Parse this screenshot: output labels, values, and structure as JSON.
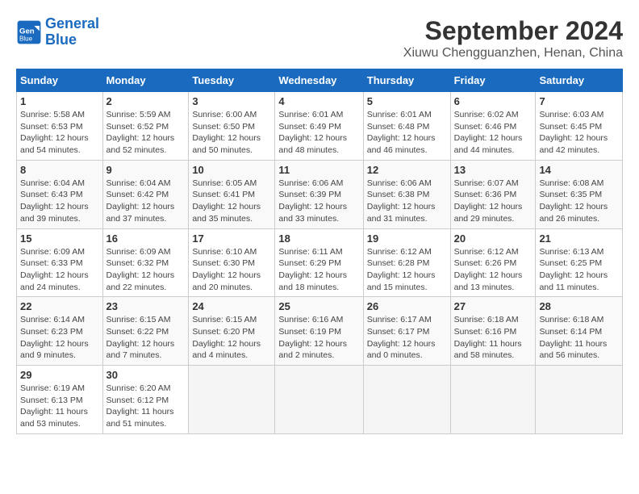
{
  "header": {
    "logo_line1": "General",
    "logo_line2": "Blue",
    "title": "September 2024",
    "subtitle": "Xiuwu Chengguanzhen, Henan, China"
  },
  "weekdays": [
    "Sunday",
    "Monday",
    "Tuesday",
    "Wednesday",
    "Thursday",
    "Friday",
    "Saturday"
  ],
  "weeks": [
    [
      {
        "day": "1",
        "sunrise": "5:58 AM",
        "sunset": "6:53 PM",
        "daylight": "12 hours and 54 minutes."
      },
      {
        "day": "2",
        "sunrise": "5:59 AM",
        "sunset": "6:52 PM",
        "daylight": "12 hours and 52 minutes."
      },
      {
        "day": "3",
        "sunrise": "6:00 AM",
        "sunset": "6:50 PM",
        "daylight": "12 hours and 50 minutes."
      },
      {
        "day": "4",
        "sunrise": "6:01 AM",
        "sunset": "6:49 PM",
        "daylight": "12 hours and 48 minutes."
      },
      {
        "day": "5",
        "sunrise": "6:01 AM",
        "sunset": "6:48 PM",
        "daylight": "12 hours and 46 minutes."
      },
      {
        "day": "6",
        "sunrise": "6:02 AM",
        "sunset": "6:46 PM",
        "daylight": "12 hours and 44 minutes."
      },
      {
        "day": "7",
        "sunrise": "6:03 AM",
        "sunset": "6:45 PM",
        "daylight": "12 hours and 42 minutes."
      }
    ],
    [
      {
        "day": "8",
        "sunrise": "6:04 AM",
        "sunset": "6:43 PM",
        "daylight": "12 hours and 39 minutes."
      },
      {
        "day": "9",
        "sunrise": "6:04 AM",
        "sunset": "6:42 PM",
        "daylight": "12 hours and 37 minutes."
      },
      {
        "day": "10",
        "sunrise": "6:05 AM",
        "sunset": "6:41 PM",
        "daylight": "12 hours and 35 minutes."
      },
      {
        "day": "11",
        "sunrise": "6:06 AM",
        "sunset": "6:39 PM",
        "daylight": "12 hours and 33 minutes."
      },
      {
        "day": "12",
        "sunrise": "6:06 AM",
        "sunset": "6:38 PM",
        "daylight": "12 hours and 31 minutes."
      },
      {
        "day": "13",
        "sunrise": "6:07 AM",
        "sunset": "6:36 PM",
        "daylight": "12 hours and 29 minutes."
      },
      {
        "day": "14",
        "sunrise": "6:08 AM",
        "sunset": "6:35 PM",
        "daylight": "12 hours and 26 minutes."
      }
    ],
    [
      {
        "day": "15",
        "sunrise": "6:09 AM",
        "sunset": "6:33 PM",
        "daylight": "12 hours and 24 minutes."
      },
      {
        "day": "16",
        "sunrise": "6:09 AM",
        "sunset": "6:32 PM",
        "daylight": "12 hours and 22 minutes."
      },
      {
        "day": "17",
        "sunrise": "6:10 AM",
        "sunset": "6:30 PM",
        "daylight": "12 hours and 20 minutes."
      },
      {
        "day": "18",
        "sunrise": "6:11 AM",
        "sunset": "6:29 PM",
        "daylight": "12 hours and 18 minutes."
      },
      {
        "day": "19",
        "sunrise": "6:12 AM",
        "sunset": "6:28 PM",
        "daylight": "12 hours and 15 minutes."
      },
      {
        "day": "20",
        "sunrise": "6:12 AM",
        "sunset": "6:26 PM",
        "daylight": "12 hours and 13 minutes."
      },
      {
        "day": "21",
        "sunrise": "6:13 AM",
        "sunset": "6:25 PM",
        "daylight": "12 hours and 11 minutes."
      }
    ],
    [
      {
        "day": "22",
        "sunrise": "6:14 AM",
        "sunset": "6:23 PM",
        "daylight": "12 hours and 9 minutes."
      },
      {
        "day": "23",
        "sunrise": "6:15 AM",
        "sunset": "6:22 PM",
        "daylight": "12 hours and 7 minutes."
      },
      {
        "day": "24",
        "sunrise": "6:15 AM",
        "sunset": "6:20 PM",
        "daylight": "12 hours and 4 minutes."
      },
      {
        "day": "25",
        "sunrise": "6:16 AM",
        "sunset": "6:19 PM",
        "daylight": "12 hours and 2 minutes."
      },
      {
        "day": "26",
        "sunrise": "6:17 AM",
        "sunset": "6:17 PM",
        "daylight": "12 hours and 0 minutes."
      },
      {
        "day": "27",
        "sunrise": "6:18 AM",
        "sunset": "6:16 PM",
        "daylight": "11 hours and 58 minutes."
      },
      {
        "day": "28",
        "sunrise": "6:18 AM",
        "sunset": "6:14 PM",
        "daylight": "11 hours and 56 minutes."
      }
    ],
    [
      {
        "day": "29",
        "sunrise": "6:19 AM",
        "sunset": "6:13 PM",
        "daylight": "11 hours and 53 minutes."
      },
      {
        "day": "30",
        "sunrise": "6:20 AM",
        "sunset": "6:12 PM",
        "daylight": "11 hours and 51 minutes."
      },
      null,
      null,
      null,
      null,
      null
    ]
  ]
}
